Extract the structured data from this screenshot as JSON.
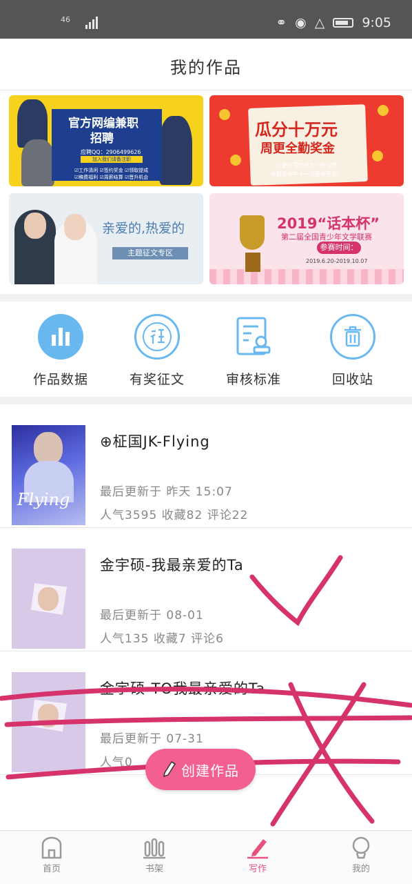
{
  "status_bar": {
    "network": "46",
    "time": "9:05",
    "icons": [
      "signal-icon",
      "headphones-icon",
      "eye-icon",
      "mute-icon",
      "battery-icon"
    ]
  },
  "header": {
    "title": "我的作品"
  },
  "banners": [
    {
      "title": "官方网编兼职",
      "subtitle": "招聘",
      "qq": "应聘QQ：2906499626",
      "tag": "加入我们请备注职",
      "points": "☑工作清闲 ☑签约奖金 ☑领取提成 ☑稿费福利 ☑周薪结算 ☑晋升机会",
      "colors": {
        "bg": "#f6d21c",
        "panel": "#1e3f8f"
      }
    },
    {
      "title": "瓜分十万元",
      "subtitle": "周更全勤奖金",
      "line1": "让更好写作成为一种习惯",
      "line2": "每周五中午十一点更新开奖！",
      "colors": {
        "bg": "#ee3b2f"
      }
    },
    {
      "title": "亲爱的,热爱的",
      "tag": "主题征文专区",
      "colors": {
        "bg": "#e9eef3",
        "accent": "#4a7db0"
      }
    },
    {
      "title": "2019“话本杯”",
      "subtitle": "第二届全国青少年文学联赛",
      "tag": "参赛时间：",
      "date": "2019.6.20-2019.10.07",
      "colors": {
        "bg": "#fbe3ea",
        "accent": "#d6336c"
      }
    }
  ],
  "menu": [
    {
      "label": "作品数据",
      "icon": "bar-chart-icon"
    },
    {
      "label": "有奖征文",
      "icon": "zheng-badge-icon"
    },
    {
      "label": "审核标准",
      "icon": "review-document-icon"
    },
    {
      "label": "回收站",
      "icon": "trash-icon"
    }
  ],
  "works": [
    {
      "title": "⊕柾国JK-Flying",
      "updated": "最后更新于  昨天  15:07",
      "stats": "人气3595 收藏82 评论22",
      "cover_text": "Flying"
    },
    {
      "title": "金宇硕-我最亲爱的Ta",
      "updated": "最后更新于  08-01",
      "stats": "人气135 收藏7 评论6"
    },
    {
      "title": "金宇硕-TO我最亲爱的Ta",
      "updated": "最后更新于  07-31",
      "stats": "人气0"
    }
  ],
  "create_button": {
    "label": "创建作品",
    "icon": "pencil-icon"
  },
  "tabbar": [
    {
      "label": "首页",
      "icon": "home-icon",
      "active": false
    },
    {
      "label": "书架",
      "icon": "bookshelf-icon",
      "active": false
    },
    {
      "label": "写作",
      "icon": "write-icon",
      "active": true
    },
    {
      "label": "我的",
      "icon": "profile-icon",
      "active": false
    }
  ],
  "colors": {
    "accent": "#e8507e",
    "icon_blue": "#6ab8f0",
    "annotation": "#d6336c"
  }
}
